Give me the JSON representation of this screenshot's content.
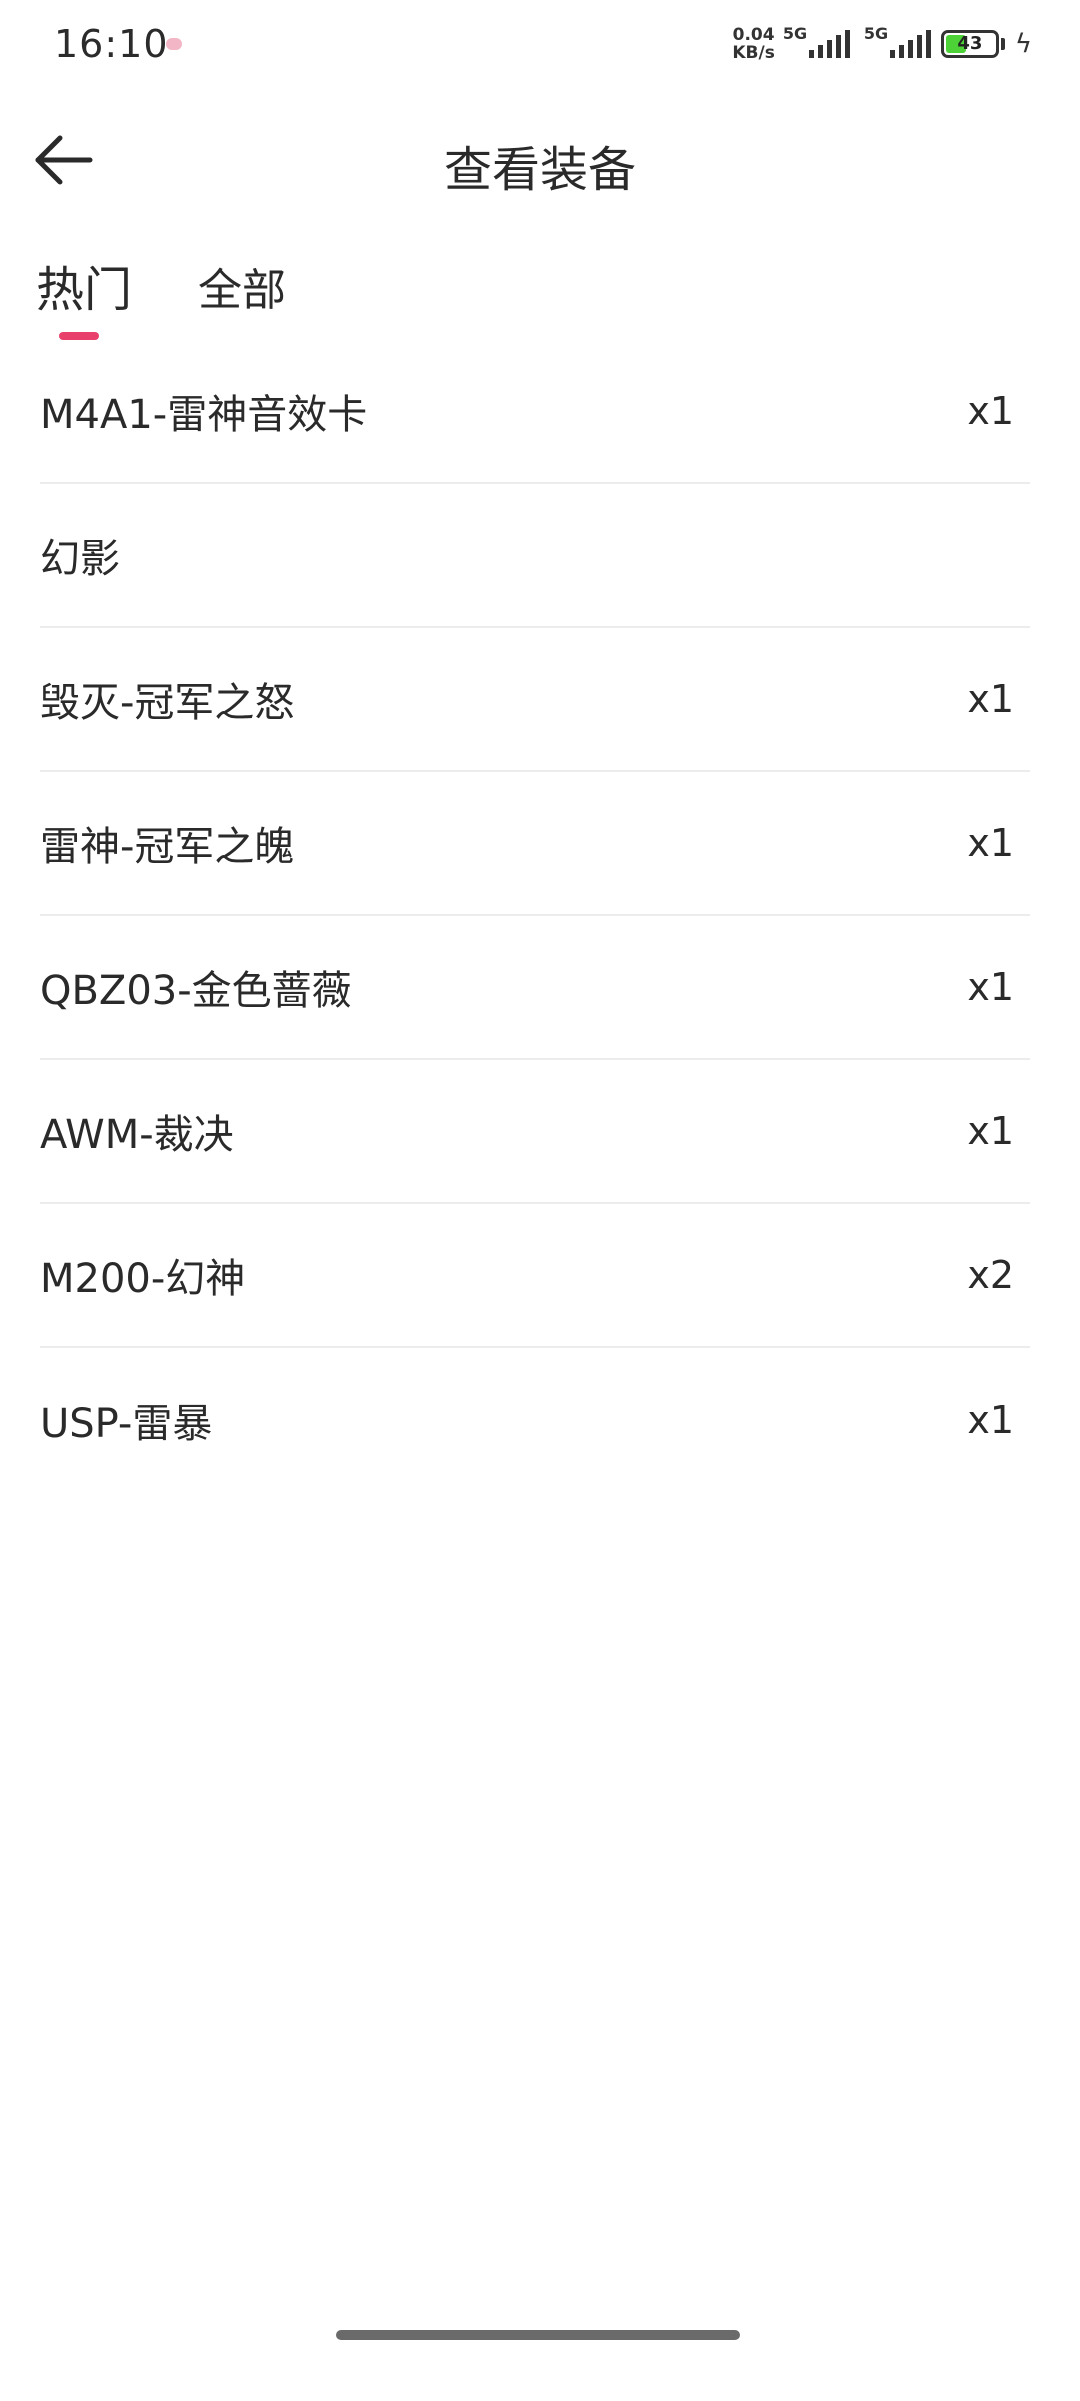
{
  "status_bar": {
    "time": "16:10",
    "net_speed_value": "0.04",
    "net_speed_unit": "KB/s",
    "signal1_gen": "5G",
    "signal2_gen": "5G",
    "battery": "43",
    "battery_level": 0.43,
    "battery_color": "#4cd137"
  },
  "header": {
    "back_icon": "arrow-left-icon",
    "title": "查看装备"
  },
  "tabs": [
    {
      "label": "热门",
      "active": true
    },
    {
      "label": "全部",
      "active": false
    }
  ],
  "accent_color": "#e8406b",
  "items": [
    {
      "name": "M4A1-雷神音效卡",
      "qty": "x1"
    },
    {
      "name": "幻影",
      "qty": ""
    },
    {
      "name": "毁灭-冠军之怒",
      "qty": "x1"
    },
    {
      "name": "雷神-冠军之魄",
      "qty": "x1"
    },
    {
      "name": "QBZ03-金色蔷薇",
      "qty": "x1"
    },
    {
      "name": "AWM-裁决",
      "qty": "x1"
    },
    {
      "name": "M200-幻神",
      "qty": "x2"
    },
    {
      "name": "USP-雷暴",
      "qty": "x1"
    }
  ]
}
